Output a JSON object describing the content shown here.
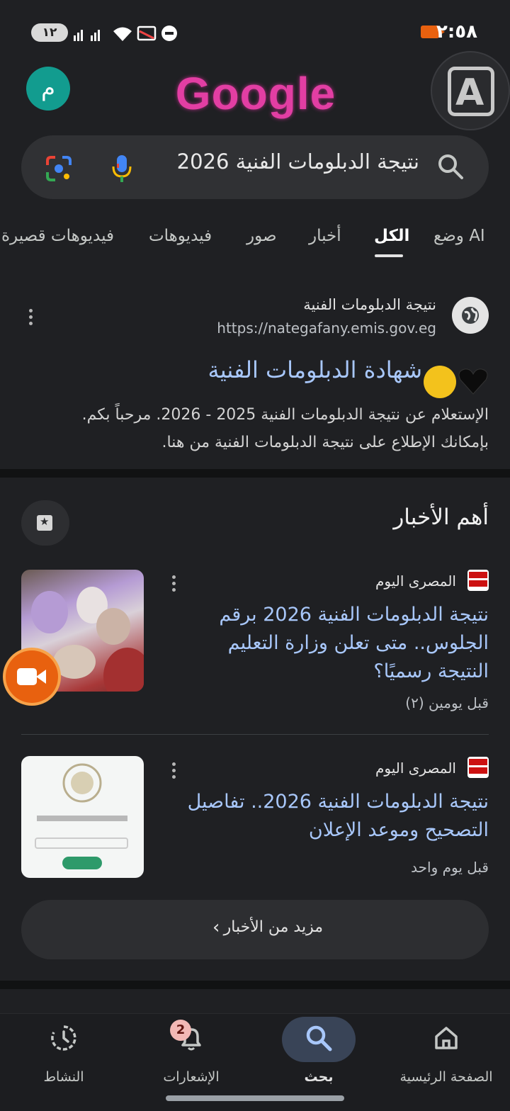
{
  "status_bar": {
    "time": "٢:٥٨",
    "battery": "١٢"
  },
  "header": {
    "avatar_letter": "م",
    "doodle_text": "Google",
    "corner_app_letter": "A"
  },
  "search": {
    "query": "نتيجة الدبلومات الفنية 2026"
  },
  "tabs": [
    {
      "label": "وضع AI"
    },
    {
      "label": "الكل"
    },
    {
      "label": "أخبار"
    },
    {
      "label": "صور"
    },
    {
      "label": "فيديوهات"
    },
    {
      "label": "فيديوهات قصيرة"
    }
  ],
  "result": {
    "site_name": "نتيجة الدبلومات الفنية",
    "url": "https://nategafany.emis.gov.eg",
    "title": "شهادة الدبلومات الفنية",
    "snippet_line1": "الإستعلام عن نتيجة الدبلومات الفنية 2025 - 2026. مرحباً بكم.",
    "snippet_line2": "بإمكانك الإطلاع على نتيجة الدبلومات الفنية من هنا."
  },
  "top_stories": {
    "heading": "أهم الأخبار",
    "items": [
      {
        "source": "المصرى اليوم",
        "title": "نتيجة الدبلومات الفنية 2026 برقم الجلوس.. متى تعلن وزارة التعليم النتيجة رسميًا؟",
        "time": "قبل يومين (٢)"
      },
      {
        "source": "المصرى اليوم",
        "title": "نتيجة الدبلومات الفنية 2026.. تفاصيل التصحيح وموعد الإعلان",
        "time": "قبل يوم واحد"
      }
    ],
    "more_label": "مزيد من الأخبار"
  },
  "bottom_nav": {
    "items": [
      {
        "label": "الصفحة الرئيسية",
        "icon": "home-icon"
      },
      {
        "label": "بحث",
        "icon": "search-icon"
      },
      {
        "label": "الإشعارات",
        "icon": "bell-icon",
        "badge": "2"
      },
      {
        "label": "النشاط",
        "icon": "activity-icon"
      }
    ]
  },
  "colors": {
    "background": "#1f2023",
    "link": "#a8c7fa",
    "accent_teal": "#129c8f",
    "recording_orange": "#e8610f"
  }
}
